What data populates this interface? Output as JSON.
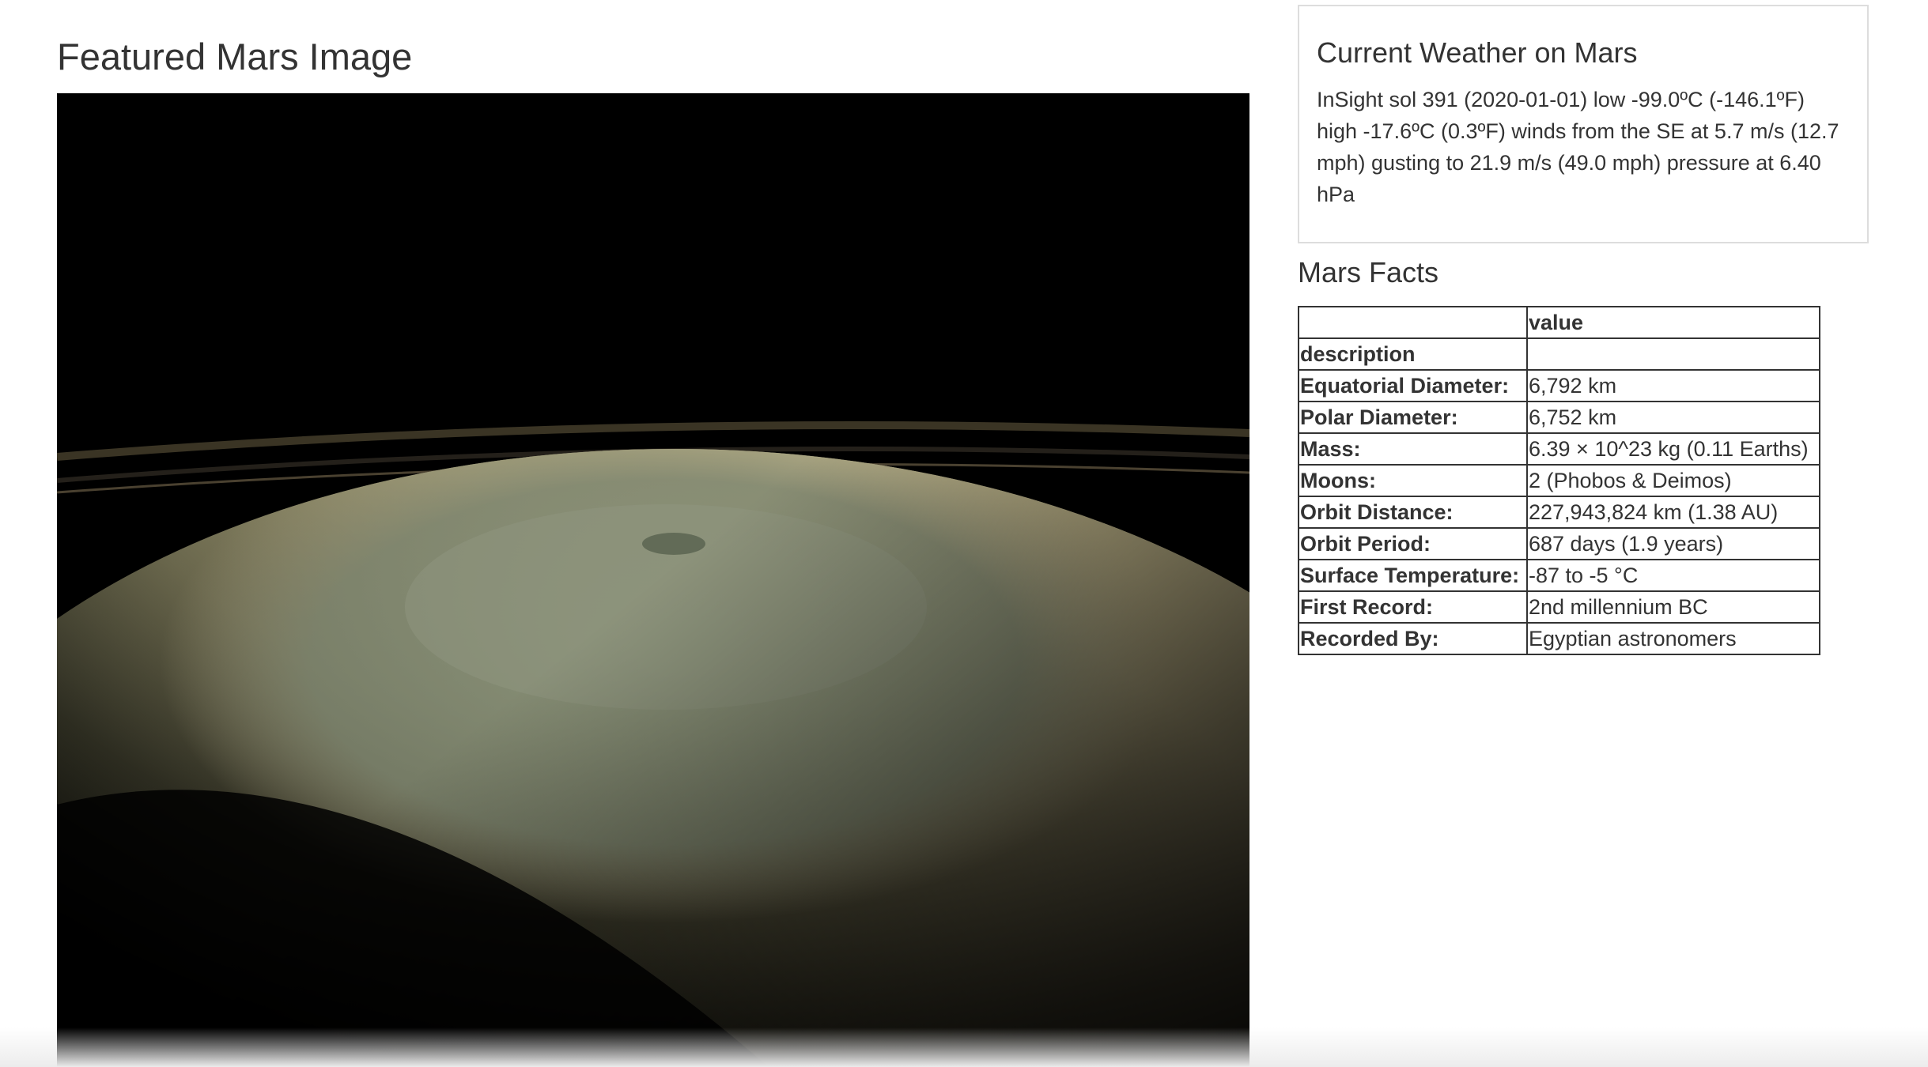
{
  "featured": {
    "title": "Featured Mars Image",
    "image_subject": "planet-north-pole-hexagon"
  },
  "weather": {
    "title": "Current Weather on Mars",
    "text": "InSight sol 391 (2020-01-01) low -99.0ºC (-146.1ºF) high -17.6ºC (0.3ºF) winds from the SE at 5.7 m/s (12.7 mph) gusting to 21.9 m/s (49.0 mph) pressure at 6.40 hPa"
  },
  "facts": {
    "title": "Mars Facts",
    "header": [
      "",
      "value"
    ],
    "rows": [
      {
        "label": "description",
        "value": ""
      },
      {
        "label": "Equatorial Diameter:",
        "value": "6,792 km"
      },
      {
        "label": "Polar Diameter:",
        "value": "6,752 km"
      },
      {
        "label": "Mass:",
        "value": "6.39 × 10^23 kg (0.11 Earths)"
      },
      {
        "label": "Moons:",
        "value": "2 (Phobos & Deimos)"
      },
      {
        "label": "Orbit Distance:",
        "value": "227,943,824 km (1.38 AU)"
      },
      {
        "label": "Orbit Period:",
        "value": "687 days (1.9 years)"
      },
      {
        "label": "Surface Temperature:",
        "value": "-87 to -5 °C"
      },
      {
        "label": "First Record:",
        "value": "2nd millennium BC"
      },
      {
        "label": "Recorded By:",
        "value": "Egyptian astronomers"
      }
    ]
  },
  "colors": {
    "text": "#333333",
    "panel_border": "#dddddd",
    "table_border": "#333333",
    "image_background": "#000000"
  }
}
